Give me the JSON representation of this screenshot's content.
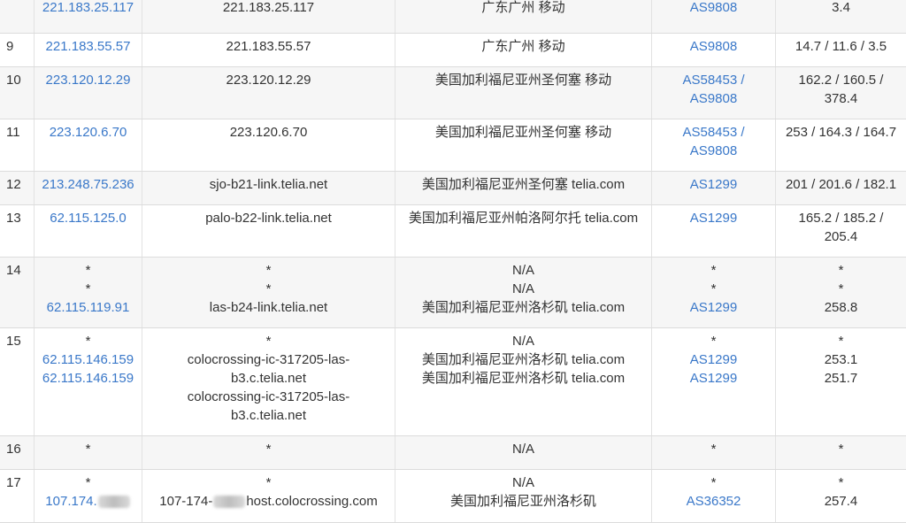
{
  "rows": [
    {
      "hop": "",
      "ip": [
        "221.183.25.117"
      ],
      "host": [
        "221.183.25.117"
      ],
      "loc": [
        "广东广州 移动"
      ],
      "asn": [
        "AS9808"
      ],
      "lat": [
        "3.4"
      ]
    },
    {
      "hop": "9",
      "ip": [
        "221.183.55.57"
      ],
      "host": [
        "221.183.55.57"
      ],
      "loc": [
        "广东广州 移动"
      ],
      "asn": [
        "AS9808"
      ],
      "lat": [
        "14.7 / 11.6 / 3.5"
      ]
    },
    {
      "hop": "10",
      "ip": [
        "223.120.12.29"
      ],
      "host": [
        "223.120.12.29"
      ],
      "loc": [
        "美国加利福尼亚州圣何塞 移动"
      ],
      "asn": [
        "AS58453 /",
        "AS9808"
      ],
      "lat": [
        "162.2 / 160.5 /",
        "378.4"
      ]
    },
    {
      "hop": "11",
      "ip": [
        "223.120.6.70"
      ],
      "host": [
        "223.120.6.70"
      ],
      "loc": [
        "美国加利福尼亚州圣何塞 移动"
      ],
      "asn": [
        "AS58453 /",
        "AS9808"
      ],
      "lat": [
        "253 / 164.3 / 164.7"
      ]
    },
    {
      "hop": "12",
      "ip": [
        "213.248.75.236"
      ],
      "host": [
        "sjo-b21-link.telia.net"
      ],
      "loc": [
        "美国加利福尼亚州圣何塞 telia.com"
      ],
      "asn": [
        "AS1299"
      ],
      "lat": [
        "201 / 201.6 / 182.1"
      ]
    },
    {
      "hop": "13",
      "ip": [
        "62.115.125.0"
      ],
      "host": [
        "palo-b22-link.telia.net"
      ],
      "loc": [
        "美国加利福尼亚州帕洛阿尔托 telia.com"
      ],
      "asn": [
        "AS1299"
      ],
      "lat": [
        "165.2 / 185.2 /",
        "205.4"
      ]
    },
    {
      "hop": "14",
      "ip": [
        "*",
        "*",
        "62.115.119.91"
      ],
      "host": [
        "*",
        "*",
        "las-b24-link.telia.net"
      ],
      "loc": [
        "N/A",
        "N/A",
        "美国加利福尼亚州洛杉矶 telia.com"
      ],
      "asn": [
        "*",
        "*",
        "AS1299"
      ],
      "lat": [
        "*",
        "*",
        "258.8"
      ]
    },
    {
      "hop": "15",
      "ip": [
        "*",
        "62.115.146.159",
        "62.115.146.159"
      ],
      "host": [
        "*",
        "colocrossing-ic-317205-las-",
        "b3.c.telia.net",
        "colocrossing-ic-317205-las-",
        "b3.c.telia.net"
      ],
      "loc": [
        "N/A",
        "美国加利福尼亚州洛杉矶 telia.com",
        "美国加利福尼亚州洛杉矶 telia.com"
      ],
      "asn": [
        "*",
        "AS1299",
        "AS1299"
      ],
      "lat": [
        "*",
        "253.1",
        "251.7"
      ]
    },
    {
      "hop": "16",
      "ip": [
        "*"
      ],
      "host": [
        "*"
      ],
      "loc": [
        "N/A"
      ],
      "asn": [
        "*"
      ],
      "lat": [
        "*"
      ]
    },
    {
      "hop": "17",
      "ip": [
        "*",
        "107.174."
      ],
      "host": [
        "*",
        "107-174-",
        "host.colocrossing.com"
      ],
      "loc": [
        "N/A",
        "美国加利福尼亚州洛杉矶"
      ],
      "asn": [
        "*",
        "AS36352"
      ],
      "lat": [
        "*",
        "257.4"
      ]
    }
  ]
}
